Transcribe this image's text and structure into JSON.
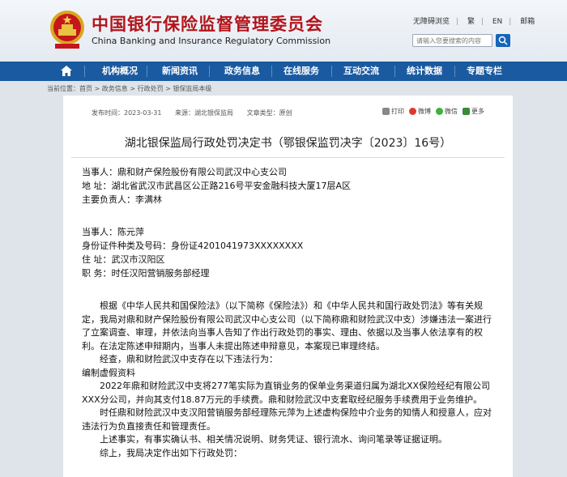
{
  "header": {
    "title_cn": "中国银行保险监督管理委员会",
    "title_en": "China Banking and Insurance Regulatory Commission",
    "links": [
      "无障碍浏览",
      "繁",
      "EN",
      "邮箱"
    ],
    "search_placeholder": "请输入您要搜索的内容"
  },
  "nav": [
    "机构概况",
    "新闻资讯",
    "政务信息",
    "在线服务",
    "互动交流",
    "统计数据",
    "专题专栏"
  ],
  "breadcrumb": "当前位置：首页 > 政务信息 > 行政处罚 > 银保监局本级",
  "article": {
    "meta": {
      "date": "发布时间：2023-03-31",
      "source": "来源：湖北银保监局",
      "type": "文章类型：原创"
    },
    "share": [
      "打印",
      "微博",
      "微信",
      "更多"
    ],
    "title": "湖北银保监局行政处罚决定书（鄂银保监罚决字〔2023〕16号）",
    "party1": [
      "当事人：鼎和财产保险股份有限公司武汉中心支公司",
      "地  址：湖北省武汉市武昌区公正路216号平安金融科技大厦17层A区",
      "主要负责人：李满林"
    ],
    "party2": [
      "当事人：陈元萍",
      "身份证件种类及号码：身份证4201041973XXXXXXXX",
      "住  址：武汉市汉阳区",
      "职  务：时任汉阳营销服务部经理"
    ],
    "paragraphs": [
      "根据《中华人民共和国保险法》（以下简称《保险法》）和《中华人民共和国行政处罚法》等有关规定，我局对鼎和财产保险股份有限公司武汉中心支公司（以下简称鼎和财险武汉中支）涉嫌违法一案进行了立案调查、审理，并依法向当事人告知了作出行政处罚的事实、理由、依据以及当事人依法享有的权利。在法定陈述申辩期内，当事人未提出陈述申辩意见，本案现已审理终结。",
      "经查，鼎和财险武汉中支存在以下违法行为：",
      "编制虚假资料",
      "2022年鼎和财险武汉中支将277笔实际为直销业务的保单业务渠道归属为湖北XX保险经纪有限公司XXX分公司，并向其支付18.87万元的手续费。鼎和财险武汉中支套取经纪服务手续费用于业务维护。",
      "时任鼎和财险武汉中支汉阳营销服务部经理陈元萍为上述虚构保险中介业务的知情人和授意人，应对违法行为负直接责任和管理责任。",
      "上述事实，有事实确认书、相关情况说明、财务凭证、银行流水、询问笔录等证据证明。",
      "综上，我局决定作出如下行政处罚："
    ]
  },
  "colors": {
    "brand_red": "#b3141b",
    "nav_blue": "#1a5aa0"
  }
}
